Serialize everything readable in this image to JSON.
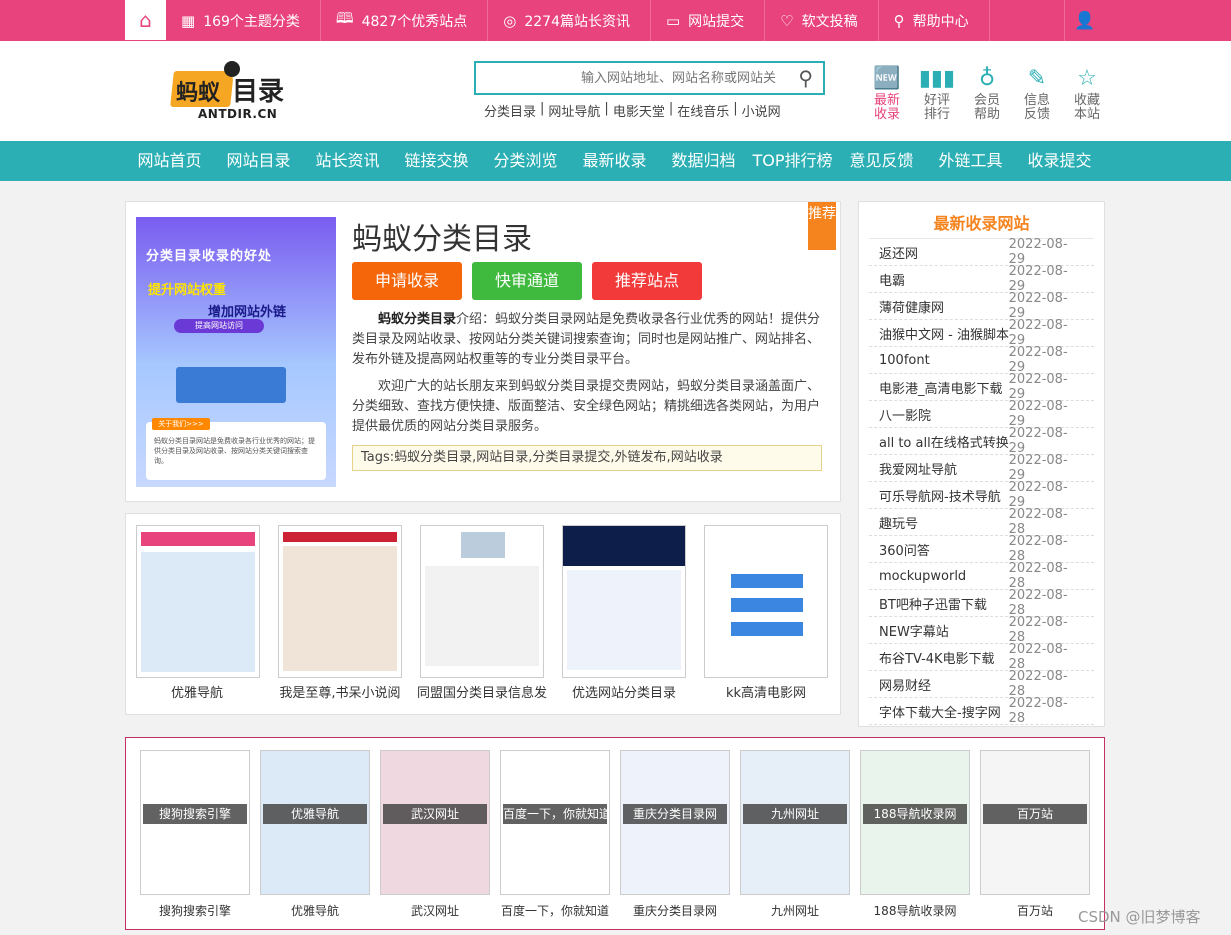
{
  "topbar": {
    "items": [
      {
        "icon": "grid-icon",
        "glyph": "▦",
        "label": "169个主题分类"
      },
      {
        "icon": "book-icon",
        "glyph": "🕮",
        "label": "4827个优秀站点"
      },
      {
        "icon": "target-icon",
        "glyph": "◎",
        "label": "2274篇站长资讯"
      },
      {
        "icon": "monitor-icon",
        "glyph": "▭",
        "label": "网站提交"
      },
      {
        "icon": "heart-icon",
        "glyph": "♡",
        "label": "软文投稿"
      },
      {
        "icon": "search-icon",
        "glyph": "⚲",
        "label": "帮助中心"
      }
    ]
  },
  "logo": {
    "main": "蚂蚁",
    "sub": "目录",
    "domain": "ANTDIR.CN"
  },
  "search": {
    "placeholder": "输入网站地址、网站名称或网站关"
  },
  "quick_links": [
    "分类目录",
    "网址导航",
    "电影天堂",
    "在线音乐",
    "小说网"
  ],
  "header_icons": [
    {
      "icon": "new-icon",
      "glyph": "🆕",
      "l1": "最新",
      "l2": "收录",
      "highlight": true
    },
    {
      "icon": "bar-chart-icon",
      "glyph": "▮",
      "l1": "好评",
      "l2": "排行",
      "highlight": false
    },
    {
      "icon": "bulb-icon",
      "glyph": "💡",
      "l1": "会员",
      "l2": "帮助",
      "highlight": false
    },
    {
      "icon": "pen-icon",
      "glyph": "✎",
      "l1": "信息",
      "l2": "反馈",
      "highlight": false
    },
    {
      "icon": "star-icon",
      "glyph": "☆",
      "l1": "收藏",
      "l2": "本站",
      "highlight": false
    }
  ],
  "nav": [
    "网站首页",
    "网站目录",
    "站长资讯",
    "链接交换",
    "分类浏览",
    "最新收录",
    "数据归档",
    "TOP排行榜",
    "意见反馈",
    "外链工具",
    "收录提交"
  ],
  "intro": {
    "title": "蚂蚁分类目录",
    "ribbon": "推荐",
    "buttons": [
      "申请收录",
      "快审通道",
      "推荐站点"
    ],
    "p1_bold": "蚂蚁分类目录",
    "p1": "介绍：蚂蚁分类目录网站是免费收录各行业优秀的网站！提供分类目录及网站收录、按网站分类关键词搜索查询；同时也是网站推广、网站排名、发布外链及提高网站权重等的专业分类目录平台。",
    "p2": "欢迎广大的站长朋友来到蚂蚁分类目录提交贵网站，蚂蚁分类目录涵盖面广、分类细致、查找方便快捷、版面整洁、安全绿色网站；精挑细选各类网站，为用户提供最优质的网站分类目录服务。",
    "tags": "Tags:蚂蚁分类目录,网站目录,分类目录提交,外链发布,网站收录",
    "banner": {
      "t1": "分类目录收录的好处",
      "t2": "提升网站权重",
      "t3": "增加网站外链",
      "t4": "提高网站访问",
      "card_label": "关于我们>>>",
      "card_text": "蚂蚁分类目录网站是免费收录各行业优秀的网站；提供分类目录及网站收录、按网站分类关键词搜索查询。"
    }
  },
  "featured": [
    "优雅导航",
    "我是至尊,书呆小说阅",
    "同盟国分类目录信息发",
    "优选网站分类目录",
    "kk高清电影网"
  ],
  "latest": {
    "title": "最新收录网站",
    "rows": [
      {
        "name": "返还网",
        "date": "2022-08-29"
      },
      {
        "name": "电霸",
        "date": "2022-08-29"
      },
      {
        "name": "薄荷健康网",
        "date": "2022-08-29"
      },
      {
        "name": "油猴中文网 - 油猴脚本",
        "date": "2022-08-29"
      },
      {
        "name": "100font",
        "date": "2022-08-29"
      },
      {
        "name": "电影港_高清电影下载",
        "date": "2022-08-29"
      },
      {
        "name": "八一影院",
        "date": "2022-08-29"
      },
      {
        "name": "all to all在线格式转换",
        "date": "2022-08-29"
      },
      {
        "name": "我爱网址导航",
        "date": "2022-08-29"
      },
      {
        "name": "可乐导航网-技术导航",
        "date": "2022-08-29"
      },
      {
        "name": "趣玩号",
        "date": "2022-08-28"
      },
      {
        "name": "360问答",
        "date": "2022-08-28"
      },
      {
        "name": "mockupworld",
        "date": "2022-08-28"
      },
      {
        "name": "BT吧种子迅雷下载",
        "date": "2022-08-28"
      },
      {
        "name": "NEW字幕站",
        "date": "2022-08-28"
      },
      {
        "name": "布谷TV-4K电影下载",
        "date": "2022-08-28"
      },
      {
        "name": "网易财经",
        "date": "2022-08-28"
      },
      {
        "name": "字体下载大全-搜字网",
        "date": "2022-08-28"
      }
    ]
  },
  "bottom_sites": [
    {
      "overlay": "搜狗搜索引擎",
      "label": "搜狗搜索引擎"
    },
    {
      "overlay": "优雅导航",
      "label": "优雅导航"
    },
    {
      "overlay": "武汉网址",
      "label": "武汉网址"
    },
    {
      "overlay": "百度一下，你就知道",
      "label": "百度一下，你就知道"
    },
    {
      "overlay": "重庆分类目录网",
      "label": "重庆分类目录网"
    },
    {
      "overlay": "九州网址",
      "label": "九州网址"
    },
    {
      "overlay": "188导航收录网",
      "label": "188导航收录网"
    },
    {
      "overlay": "百万站",
      "label": "百万站"
    }
  ],
  "watermark": "CSDN @旧梦博客",
  "colors": {
    "pink": "#e8437c",
    "teal": "#2bafb4",
    "orange": "#f5841f"
  }
}
